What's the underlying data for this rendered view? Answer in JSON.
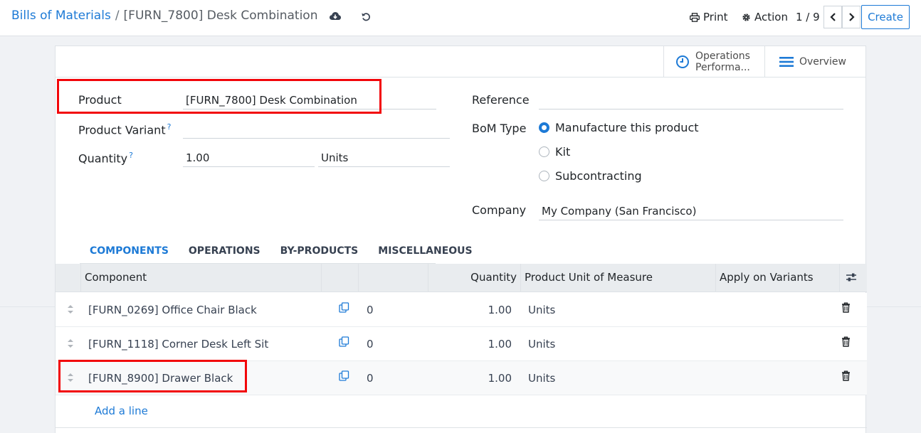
{
  "breadcrumb": {
    "parent": "Bills of Materials",
    "separator": "/",
    "current": "[FURN_7800] Desk Combination"
  },
  "header": {
    "print_label": "Print",
    "action_label": "Action",
    "pager_value": "1 / 9",
    "create_label": "Create"
  },
  "smart_buttons": {
    "operations_line1": "Operations",
    "operations_line2": "Performa...",
    "overview": "Overview"
  },
  "form": {
    "product_label": "Product",
    "product_value": "[FURN_7800] Desk Combination",
    "variant_label": "Product Variant",
    "variant_value": "",
    "quantity_label": "Quantity",
    "quantity_value": "1.00",
    "quantity_uom": "Units",
    "help_mark": "?",
    "reference_label": "Reference",
    "reference_value": "",
    "bom_type_label": "BoM Type",
    "bom_type_options": [
      "Manufacture this product",
      "Kit",
      "Subcontracting"
    ],
    "bom_type_selected": "Manufacture this product",
    "company_label": "Company",
    "company_value": "My Company (San Francisco)"
  },
  "tabs": [
    "COMPONENTS",
    "OPERATIONS",
    "BY-PRODUCTS",
    "MISCELLANEOUS"
  ],
  "table": {
    "headers": {
      "component": "Component",
      "quantity": "Quantity",
      "uom": "Product Unit of Measure",
      "variants": "Apply on Variants"
    },
    "rows": [
      {
        "component": "[FURN_0269] Office Chair Black",
        "count": "0",
        "quantity": "1.00",
        "uom": "Units"
      },
      {
        "component": "[FURN_1118] Corner Desk Left Sit",
        "count": "0",
        "quantity": "1.00",
        "uom": "Units"
      },
      {
        "component": "[FURN_8900] Drawer Black",
        "count": "0",
        "quantity": "1.00",
        "uom": "Units"
      }
    ],
    "add_line": "Add a line"
  },
  "colors": {
    "accent": "#1d7ad6",
    "highlight": "#f2060a"
  }
}
